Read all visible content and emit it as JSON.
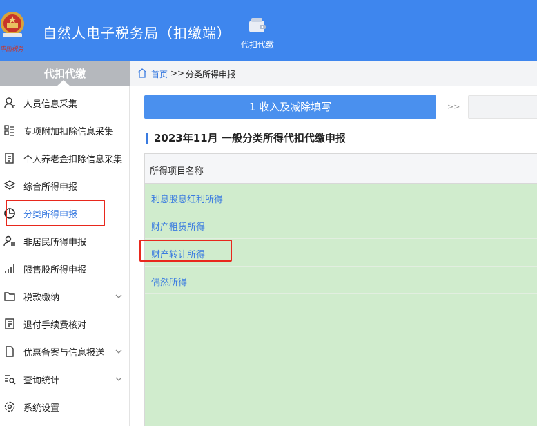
{
  "header": {
    "app_title": "自然人电子税务局（扣缴端）",
    "emblem_text": "中国税务",
    "top_nav_label": "代扣代缴",
    "top_nav_icon": "wallet-icon",
    "background": "#3e86ee"
  },
  "sidebar": {
    "title": "代扣代缴",
    "items": [
      {
        "label": "人员信息采集",
        "icon": "person-icon"
      },
      {
        "label": "专项附加扣除信息采集",
        "icon": "list-icon"
      },
      {
        "label": "个人养老金扣除信息采集",
        "icon": "document-icon"
      },
      {
        "label": "综合所得申报",
        "icon": "layers-icon"
      },
      {
        "label": "分类所得申报",
        "icon": "pie-chart-icon",
        "active": true
      },
      {
        "label": "非居民所得申报",
        "icon": "person-list-icon"
      },
      {
        "label": "限售股所得申报",
        "icon": "bar-chart-icon"
      },
      {
        "label": "税款缴纳",
        "icon": "folder-icon",
        "expandable": true
      },
      {
        "label": "退付手续费核对",
        "icon": "receipt-icon"
      },
      {
        "label": "优惠备案与信息报送",
        "icon": "file-icon",
        "expandable": true
      },
      {
        "label": "查询统计",
        "icon": "search-list-icon",
        "expandable": true
      },
      {
        "label": "系统设置",
        "icon": "gear-icon"
      }
    ]
  },
  "breadcrumb": {
    "home": "首页",
    "separator": ">>",
    "current": "分类所得申报"
  },
  "main": {
    "step_active_label": "1 收入及减除填写",
    "step_arrow": ">>",
    "section_title": "2023年11月   一般分类所得代扣代缴申报",
    "table": {
      "column_header": "所得项目名称",
      "rows": [
        "利息股息红利所得",
        "财产租赁所得",
        "财产转让所得",
        "偶然所得"
      ]
    }
  },
  "colors": {
    "accent": "#3a7be0",
    "row_background": "#d0eccd",
    "annotation": "#e8281d"
  }
}
